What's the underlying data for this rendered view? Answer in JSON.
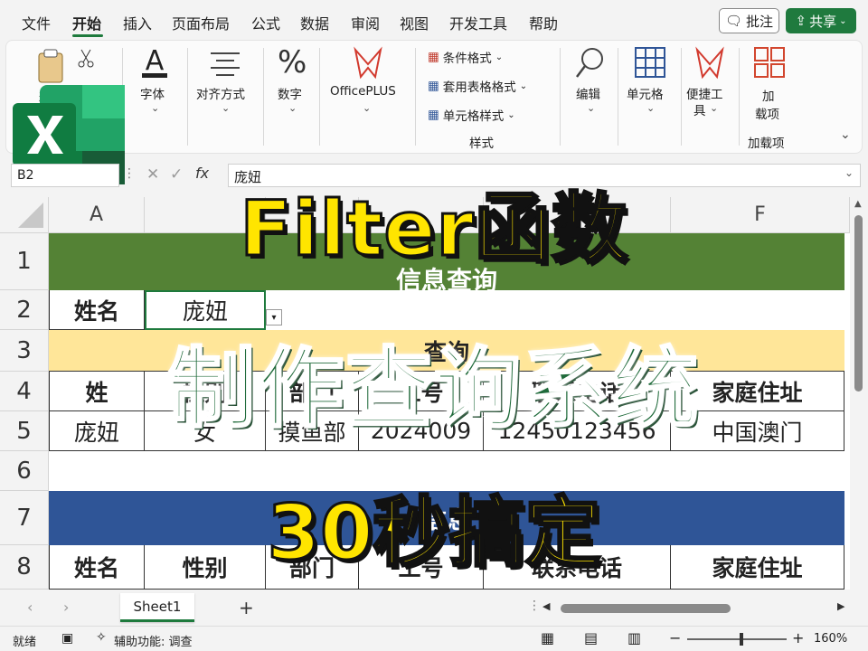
{
  "menu": {
    "items": [
      "文件",
      "开始",
      "插入",
      "页面布局",
      "公式",
      "数据",
      "审阅",
      "视图",
      "开发工具",
      "帮助"
    ],
    "active": "开始",
    "comment_label": "批注",
    "share_label": "共享"
  },
  "ribbon": {
    "paste_label": "粘",
    "font_label": "字体",
    "align_label": "对齐方式",
    "number_label": "数字",
    "officeplus_label": "OfficePLUS",
    "cond_format_label": "条件格式",
    "table_format_label": "套用表格格式",
    "cell_style_label": "单元格样式",
    "styles_group_label": "样式",
    "edit_label": "编辑",
    "cells_label": "单元格",
    "quick_tools_label1": "便捷工",
    "quick_tools_label2": "具",
    "addin_label1": "加",
    "addin_label2": "载项",
    "addin_group_label": "加载项"
  },
  "formula_bar": {
    "cell_ref": "B2",
    "fx": "fx",
    "value": "庞妞"
  },
  "columns": [
    "A",
    "F"
  ],
  "rows": [
    "1",
    "2",
    "3",
    "4",
    "5",
    "6",
    "7",
    "8"
  ],
  "sheet": {
    "row1_title": "信息查询",
    "row2": {
      "label": "姓名",
      "value": "庞妞"
    },
    "row3_title": "查询",
    "row4_headers": [
      "姓",
      "性别",
      "部门",
      "工号",
      "联系电话",
      "家庭住址"
    ],
    "row5_values": [
      "庞妞",
      "女",
      "摸鱼部",
      "2024009",
      "12450123456",
      "中国澳门"
    ],
    "row7_title": "信息",
    "row8_headers": [
      "姓名",
      "性别",
      "部门",
      "工号",
      "联系电话",
      "家庭住址"
    ],
    "colors": {
      "green_band": "#548235",
      "yellow_band": "#ffe699",
      "blue_band": "#2f5597"
    }
  },
  "tabs": {
    "sheet1": "Sheet1",
    "add": "+"
  },
  "status": {
    "ready": "就绪",
    "accessibility": "辅助功能: 调查",
    "zoom": "160%"
  },
  "overlay": {
    "line1": "Filter函数",
    "line2": "制作查询系统",
    "line3": "30秒搞定"
  }
}
